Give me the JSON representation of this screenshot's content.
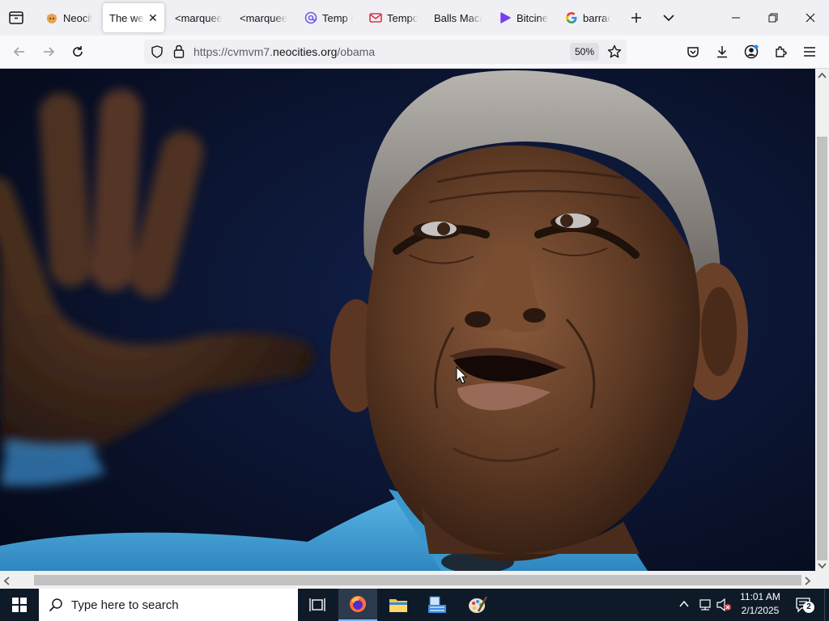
{
  "browser": {
    "tabs": [
      {
        "title": "Neocit",
        "icon": "neocities-cat-icon",
        "active": false
      },
      {
        "title": "The web",
        "icon": "none",
        "active": true
      },
      {
        "title": "<marquee",
        "icon": "none",
        "active": false
      },
      {
        "title": "<marquee",
        "icon": "none",
        "active": false
      },
      {
        "title": "Temp M",
        "icon": "at-sign-icon",
        "active": false
      },
      {
        "title": "Tempo",
        "icon": "mail-icon",
        "active": false
      },
      {
        "title": "Balls Macar",
        "icon": "none",
        "active": false
      },
      {
        "title": "Bitcine",
        "icon": "play-icon",
        "active": false
      },
      {
        "title": "barrack",
        "icon": "google-icon",
        "active": false
      }
    ],
    "url": {
      "scheme": "https://",
      "host_prefix": "cvmvm7.",
      "host": "neocities.org",
      "path": "/obama"
    },
    "zoom": "50%"
  },
  "content": {
    "image_subject": "obama-closeup-photo"
  },
  "taskbar": {
    "search_placeholder": "Type here to search",
    "time": "11:01 AM",
    "date": "2/1/2025",
    "notification_count": "2"
  },
  "colors": {
    "tabstrip_bg": "#f0f0f4",
    "navbar_bg": "#f9f9fb",
    "taskbar_bg": "#0f1a29",
    "photo_bg": "#0b1230",
    "shirt_blue": "#4aa8d8"
  }
}
